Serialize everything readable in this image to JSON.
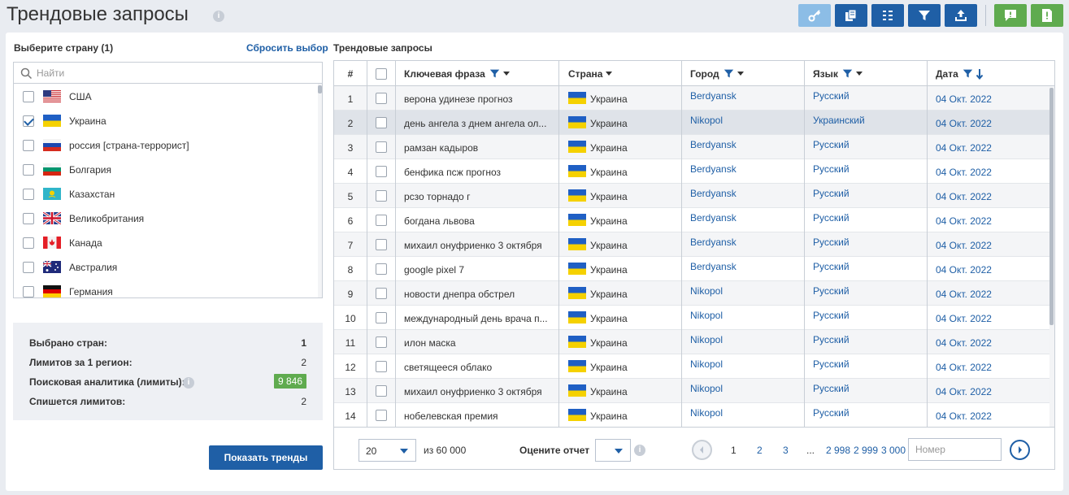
{
  "page": {
    "title": "Трендовые запросы"
  },
  "left": {
    "title": "Выберите страну (1)",
    "reset": "Сбросить выбор",
    "search_placeholder": "Найти",
    "countries": [
      {
        "name": "США",
        "checked": false,
        "flag": "us"
      },
      {
        "name": "Украина",
        "checked": true,
        "flag": "ua"
      },
      {
        "name": "россия [страна-террорист]",
        "checked": false,
        "flag": "ru"
      },
      {
        "name": "Болгария",
        "checked": false,
        "flag": "bg"
      },
      {
        "name": "Казахстан",
        "checked": false,
        "flag": "kz"
      },
      {
        "name": "Великобритания",
        "checked": false,
        "flag": "gb"
      },
      {
        "name": "Канада",
        "checked": false,
        "flag": "ca"
      },
      {
        "name": "Австралия",
        "checked": false,
        "flag": "au"
      },
      {
        "name": "Германия",
        "checked": false,
        "flag": "de"
      }
    ],
    "summary": {
      "countries_label": "Выбрано стран:",
      "countries_value": "1",
      "limits_label": "Лимитов за 1 регион:",
      "limits_value": "2",
      "analytics_label": "Поисковая аналитика (лимиты):",
      "analytics_value": "9 846",
      "charge_label": "Спишется лимитов:",
      "charge_value": "2"
    },
    "show_button": "Показать тренды"
  },
  "right": {
    "title": "Трендовые запросы",
    "headers": {
      "num": "#",
      "phrase": "Ключевая фраза",
      "country": "Страна",
      "city": "Город",
      "lang": "Язык",
      "date": "Дата"
    },
    "rows": [
      {
        "n": "1",
        "phrase": "верона удинезе прогноз",
        "country": "Украина",
        "city": "Berdyansk",
        "lang": "Русский",
        "date": "04 Окт. 2022"
      },
      {
        "n": "2",
        "phrase": "день ангела з днем ангела ол...",
        "country": "Украина",
        "city": "Nikopol",
        "lang": "Украинский",
        "date": "04 Окт. 2022"
      },
      {
        "n": "3",
        "phrase": "рамзан кадыров",
        "country": "Украина",
        "city": "Berdyansk",
        "lang": "Русский",
        "date": "04 Окт. 2022"
      },
      {
        "n": "4",
        "phrase": "бенфика псж прогноз",
        "country": "Украина",
        "city": "Berdyansk",
        "lang": "Русский",
        "date": "04 Окт. 2022"
      },
      {
        "n": "5",
        "phrase": "рсзо торнадо г",
        "country": "Украина",
        "city": "Berdyansk",
        "lang": "Русский",
        "date": "04 Окт. 2022"
      },
      {
        "n": "6",
        "phrase": "богдана львова",
        "country": "Украина",
        "city": "Berdyansk",
        "lang": "Русский",
        "date": "04 Окт. 2022"
      },
      {
        "n": "7",
        "phrase": "михаил онуфриенко 3 октября",
        "country": "Украина",
        "city": "Berdyansk",
        "lang": "Русский",
        "date": "04 Окт. 2022"
      },
      {
        "n": "8",
        "phrase": "google pixel 7",
        "country": "Украина",
        "city": "Berdyansk",
        "lang": "Русский",
        "date": "04 Окт. 2022"
      },
      {
        "n": "9",
        "phrase": "новости днепра обстрел",
        "country": "Украина",
        "city": "Nikopol",
        "lang": "Русский",
        "date": "04 Окт. 2022"
      },
      {
        "n": "10",
        "phrase": "международный день врача п...",
        "country": "Украина",
        "city": "Nikopol",
        "lang": "Русский",
        "date": "04 Окт. 2022"
      },
      {
        "n": "11",
        "phrase": "илон маска",
        "country": "Украина",
        "city": "Nikopol",
        "lang": "Русский",
        "date": "04 Окт. 2022"
      },
      {
        "n": "12",
        "phrase": "светящееся облако",
        "country": "Украина",
        "city": "Nikopol",
        "lang": "Русский",
        "date": "04 Окт. 2022"
      },
      {
        "n": "13",
        "phrase": "михаил онуфриенко 3 октября",
        "country": "Украина",
        "city": "Nikopol",
        "lang": "Русский",
        "date": "04 Окт. 2022"
      },
      {
        "n": "14",
        "phrase": "нобелевская премия",
        "country": "Украина",
        "city": "Nikopol",
        "lang": "Русский",
        "date": "04 Окт. 2022"
      }
    ],
    "footer": {
      "per_page": "20",
      "of_total": "из 60 000",
      "rate_label": "Оцените отчет",
      "pages": [
        "1",
        "2",
        "3",
        "...",
        "2 998",
        "2 999",
        "3 000"
      ],
      "page_input_placeholder": "Номер"
    }
  },
  "colors": {
    "accent": "#1f5fa6",
    "green": "#5fab4f",
    "light_blue": "#8cbde6"
  }
}
